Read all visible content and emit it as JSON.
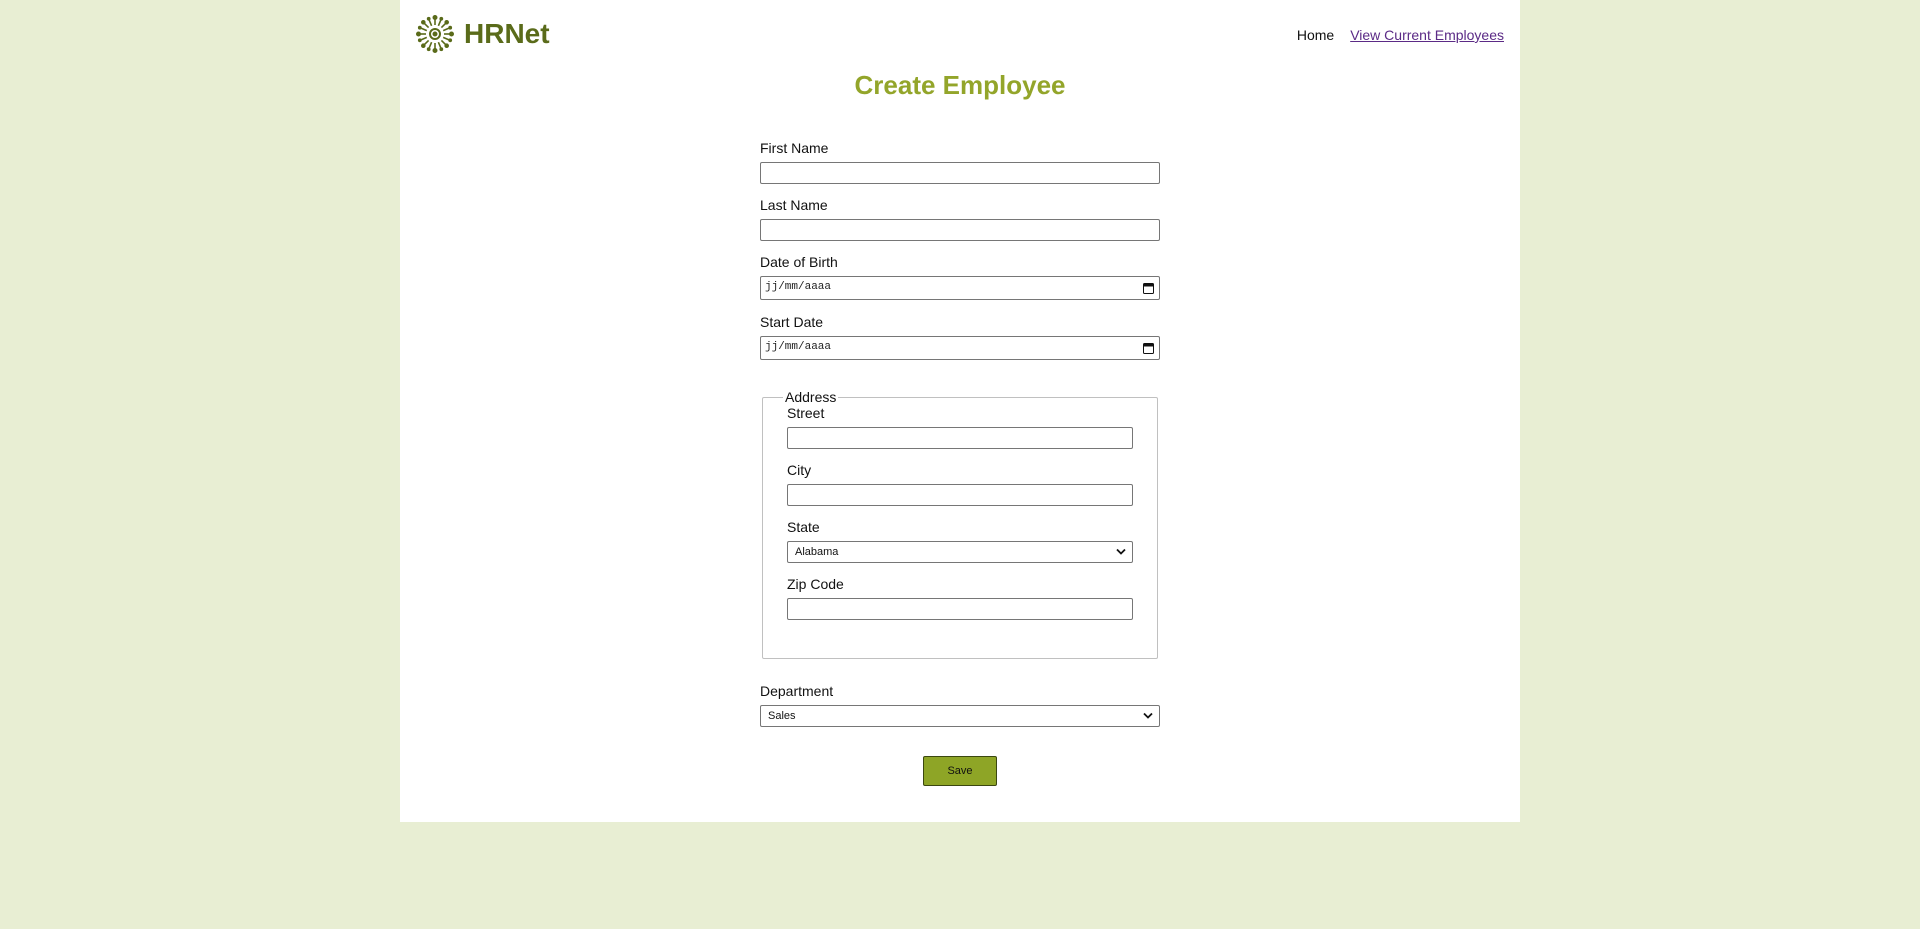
{
  "header": {
    "brand": "HRNet",
    "nav": {
      "home": "Home",
      "view_employees": "View Current Employees"
    }
  },
  "main": {
    "title": "Create Employee",
    "fields": {
      "first_name": {
        "label": "First Name",
        "value": ""
      },
      "last_name": {
        "label": "Last Name",
        "value": ""
      },
      "date_of_birth": {
        "label": "Date of Birth",
        "placeholder": "jj/mm/aaaa"
      },
      "start_date": {
        "label": "Start Date",
        "placeholder": "jj/mm/aaaa"
      }
    },
    "address": {
      "legend": "Address",
      "street": {
        "label": "Street",
        "value": ""
      },
      "city": {
        "label": "City",
        "value": ""
      },
      "state": {
        "label": "State",
        "selected": "Alabama"
      },
      "zip": {
        "label": "Zip Code",
        "value": ""
      }
    },
    "department": {
      "label": "Department",
      "selected": "Sales"
    },
    "save_label": "Save"
  },
  "colors": {
    "background": "#e8eed3",
    "title": "#93a52a",
    "brand": "#5a6b1a",
    "button": "#8ea526",
    "visited_link": "#5b2a86"
  },
  "icons": {
    "logo": "hrnet-logo-icon",
    "calendar": "calendar-icon",
    "dropdown": "chevron-down-icon"
  }
}
